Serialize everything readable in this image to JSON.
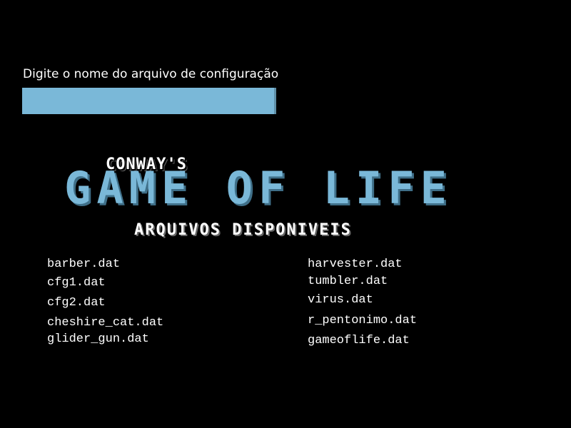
{
  "prompt": {
    "label": "Digite o nome do arquivo de configuração",
    "value": ""
  },
  "title": {
    "subtitle": "Conway's",
    "main": "Game of Life"
  },
  "files_heading": "Arquivos disponiveis",
  "files": {
    "left": [
      "barber.dat",
      "cfg1.dat",
      "cfg2.dat",
      "cheshire_cat.dat",
      "glider_gun.dat"
    ],
    "right": [
      "harvester.dat",
      "tumbler.dat",
      "virus.dat",
      "r_pentonimo.dat",
      "gameoflife.dat"
    ]
  },
  "colors": {
    "background": "#000000",
    "accent": "#7ab8d8",
    "text": "#ffffff"
  }
}
